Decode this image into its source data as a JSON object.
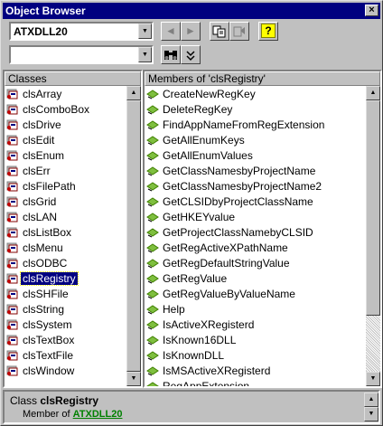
{
  "window": {
    "title": "Object Browser",
    "close_glyph": "×"
  },
  "toolbar": {
    "library_value": "ATXDLL20",
    "search_value": "",
    "back_glyph": "◄",
    "forward_glyph": "►",
    "help_glyph": "?"
  },
  "classes": {
    "header": "Classes",
    "items": [
      "clsArray",
      "clsComboBox",
      "clsDrive",
      "clsEdit",
      "clsEnum",
      "clsErr",
      "clsFilePath",
      "clsGrid",
      "clsLAN",
      "clsListBox",
      "clsMenu",
      "clsODBC",
      "clsRegistry",
      "clsSHFile",
      "clsString",
      "clsSystem",
      "clsTextBox",
      "clsTextFile",
      "clsWindow"
    ],
    "selected": "clsRegistry"
  },
  "members": {
    "header": "Members of 'clsRegistry'",
    "items": [
      "CreateNewRegKey",
      "DeleteRegKey",
      "FindAppNameFromRegExtension",
      "GetAllEnumKeys",
      "GetAllEnumValues",
      "GetClassNamesbyProjectName",
      "GetClassNamesbyProjectName2",
      "GetCLSIDbyProjectClassName",
      "GetHKEYvalue",
      "GetProjectClassNamebyCLSID",
      "GetRegActiveXPathName",
      "GetRegDefaultStringValue",
      "GetRegValue",
      "GetRegValueByValueName",
      "Help",
      "IsActiveXRegisterd",
      "IsKnown16DLL",
      "IsKnownDLL",
      "IsMSActiveXRegisterd",
      "RegAppExtension"
    ]
  },
  "details": {
    "class_prefix": "Class",
    "class_name": "clsRegistry",
    "member_of_prefix": "Member of",
    "member_of_link": "ATXDLL20"
  },
  "colors": {
    "selection": "#000080",
    "link": "#008000",
    "window_bg": "#c0c0c0"
  },
  "icons": {
    "class": "class-module-icon",
    "member": "method-icon"
  }
}
